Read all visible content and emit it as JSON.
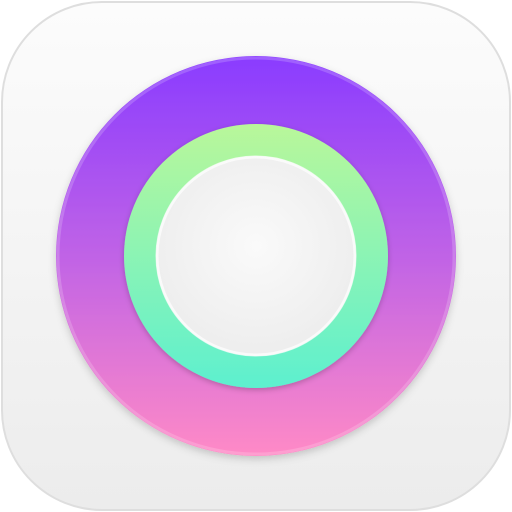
{
  "icon": {
    "name": "circular-rings-app-icon",
    "colors": {
      "tile_top": "#fcfcfc",
      "tile_bottom": "#ececec",
      "tile_edge": "#dedede",
      "outer_ring_top": "#8a3cff",
      "outer_ring_mid": "#c063e6",
      "outer_ring_bottom": "#ff8ac6",
      "inner_ring_top": "#b9f79a",
      "inner_ring_bottom": "#5df0cf",
      "center": "#f2f2f2"
    }
  }
}
